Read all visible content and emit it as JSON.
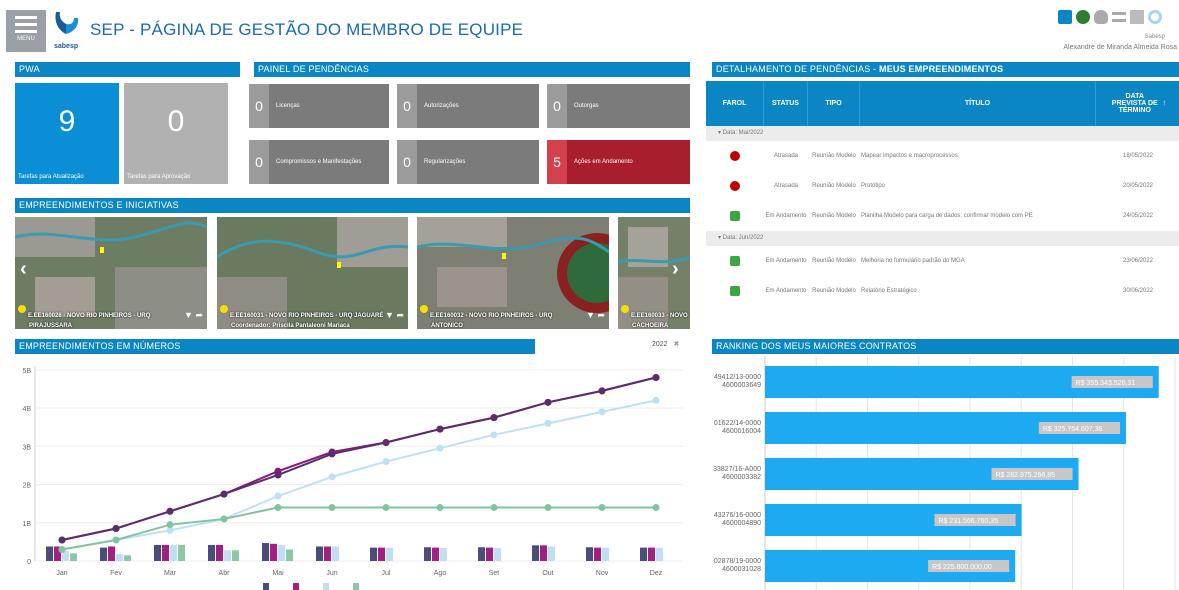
{
  "header": {
    "menu_label": "MENU",
    "logo_text": "sabesp",
    "title": "SEP - PÁGINA DE GESTÃO DO MEMBRO DE EQUIPE",
    "user_name": "Alexandre de Miranda Almeida Rosa",
    "small_brand": "Sabesp"
  },
  "sections": {
    "pwa": "PWA",
    "painel": "PAINEL DE PENDÊNCIAS",
    "detalhamento_prefix": "DETALHAMENTO DE PENDÊNCIAS - ",
    "detalhamento_bold": "MEUS EMPREENDIMENTOS",
    "empreendimentos": "EMPREENDIMENTOS E INICIATIVAS",
    "numeros": "EMPREENDIMENTOS EM NÚMEROS",
    "ranking": "RANKING DOS MEUS MAIORES CONTRATOS"
  },
  "pwa": [
    {
      "value": "9",
      "label": "Tarefas para Atualização",
      "color": "#0a8fd6"
    },
    {
      "value": "0",
      "label": "Tarefas para Aprovação",
      "color": "#b1b1b1"
    }
  ],
  "painel": [
    {
      "value": "0",
      "label": "Licenças"
    },
    {
      "value": "0",
      "label": "Autorizações"
    },
    {
      "value": "0",
      "label": "Outorgas"
    },
    {
      "value": "0",
      "label": "Compromissos e Manifestações"
    },
    {
      "value": "0",
      "label": "Regularizações"
    },
    {
      "value": "5",
      "label": "Ações em Andamento"
    }
  ],
  "projects": [
    {
      "line1": "E.EE160026 - NOVO RIO PINHEIROS - URQ",
      "line2": "PIRAJUSSARA"
    },
    {
      "line1": "E.EE160031 - NOVO RIO PINHEIROS - URQ JAGUARÉ",
      "line2": "Coordenador: Priscila Pantaleoni Mariaca"
    },
    {
      "line1": "E.EE160032 - NOVO RIO PINHEIROS - URQ",
      "line2": "ANTONICO"
    },
    {
      "line1": "E.EE160033 - NOVO",
      "line2": "CACHOEIRA"
    }
  ],
  "table": {
    "headers": [
      "FAROL",
      "STATUS",
      "TIPO",
      "TÍTULO",
      "DATA PREVISTA DE TÉRMINO"
    ],
    "sort_icon": "↑",
    "groups": [
      {
        "label": "Data: Mai/2022",
        "rows": [
          {
            "farol": "red",
            "status": "Atrasada",
            "tipo": "Reunião Modelo",
            "titulo": "Mapear impactos e macroprocessos",
            "data": "18/05/2022"
          },
          {
            "farol": "red",
            "status": "Atrasada",
            "tipo": "Reunião Modelo",
            "titulo": "Protótipo",
            "data": "20/05/2022"
          },
          {
            "farol": "green",
            "status": "Em Andamento",
            "tipo": "Reunião Modelo",
            "titulo": "Planilha Modelo para carga de dados: confirmar modelo com PE",
            "data": "24/05/2022"
          }
        ]
      },
      {
        "label": "Data: Jun/2022",
        "rows": [
          {
            "farol": "green",
            "status": "Em Andamento",
            "tipo": "Reunião Modelo",
            "titulo": "Melhoria no formulário padrão do MGA",
            "data": "23/06/2022"
          },
          {
            "farol": "green",
            "status": "Em Andamento",
            "tipo": "Reunião Modelo",
            "titulo": "Relatório Estratégico",
            "data": "30/06/2022"
          }
        ]
      }
    ]
  },
  "year_filter": "2022",
  "year_close": "✖",
  "colors": {
    "accent": "#0a86c4",
    "red": "#c00000",
    "green": "#3aa640",
    "bar_blue": "#1eaaf0"
  },
  "chart_data": [
    {
      "type": "line",
      "x": [
        "Jan",
        "Fev",
        "Mar",
        "Abr",
        "Mai",
        "Jun",
        "Jul",
        "Ago",
        "Set",
        "Out",
        "Nov",
        "Dez"
      ],
      "ytick_labels": [
        "0",
        "1B",
        "2B",
        "3B",
        "4B",
        "5B"
      ],
      "ylim": [
        0,
        5.1
      ],
      "series": [
        {
          "color": "#8b1a7a",
          "values": [
            0.55,
            0.85,
            1.3,
            1.75,
            2.35,
            2.85,
            3.1,
            3.45,
            3.75,
            4.15,
            4.45,
            4.8
          ],
          "kind": "line"
        },
        {
          "color": "#5a2d6e",
          "values": [
            0.55,
            0.85,
            1.3,
            1.75,
            2.25,
            2.8,
            3.1,
            3.45,
            3.75,
            4.15,
            4.45,
            4.8
          ],
          "kind": "line"
        },
        {
          "color": "#bfe0f3",
          "values": [
            0.3,
            0.55,
            0.8,
            1.1,
            1.7,
            2.2,
            2.6,
            2.95,
            3.3,
            3.6,
            3.9,
            4.2
          ],
          "kind": "line"
        },
        {
          "color": "#82c4a0",
          "values": [
            0.3,
            0.55,
            0.95,
            1.1,
            1.4,
            1.4,
            1.4,
            1.4,
            1.4,
            1.4,
            1.4,
            1.4
          ],
          "kind": "line"
        },
        {
          "color": "#4c4c7a",
          "values": [
            0.38,
            0.35,
            0.42,
            0.42,
            0.47,
            0.38,
            0.35,
            0.36,
            0.36,
            0.41,
            0.36,
            0.35
          ],
          "kind": "bar"
        },
        {
          "color": "#a21f83",
          "values": [
            0.38,
            0.38,
            0.42,
            0.42,
            0.45,
            0.38,
            0.35,
            0.35,
            0.35,
            0.41,
            0.35,
            0.35
          ],
          "kind": "bar"
        },
        {
          "color": "#c1def2",
          "values": [
            0.26,
            0.18,
            0.42,
            0.28,
            0.42,
            0.38,
            0.35,
            0.34,
            0.34,
            0.38,
            0.35,
            0.35
          ],
          "kind": "bar"
        },
        {
          "color": "#8cc7a6",
          "values": [
            0.2,
            0.15,
            0.42,
            0.28,
            0.3,
            0.0,
            0.0,
            0.0,
            0.0,
            0.0,
            0.0,
            0.0
          ],
          "kind": "bar"
        }
      ]
    },
    {
      "type": "bar",
      "orientation": "horizontal",
      "categories": [
        "49412/13-0000\n4600003649",
        "01622/14-0000\n4600016004",
        "33827/16-A000\n4600003382",
        "43276/16-0000\n4600004890",
        "02878/19-0000\n4600031028"
      ],
      "values": [
        355343520.31,
        325764607.36,
        282975266.85,
        231566760.35,
        225800000.0
      ],
      "data_labels": [
        "R$ 355.343.520,31",
        "R$ 325.764.607,36",
        "R$ 282.975.266,85",
        "R$ 231.566.760,35",
        "R$ 225.800.000,00"
      ],
      "xlim": [
        0,
        370000000
      ]
    }
  ]
}
